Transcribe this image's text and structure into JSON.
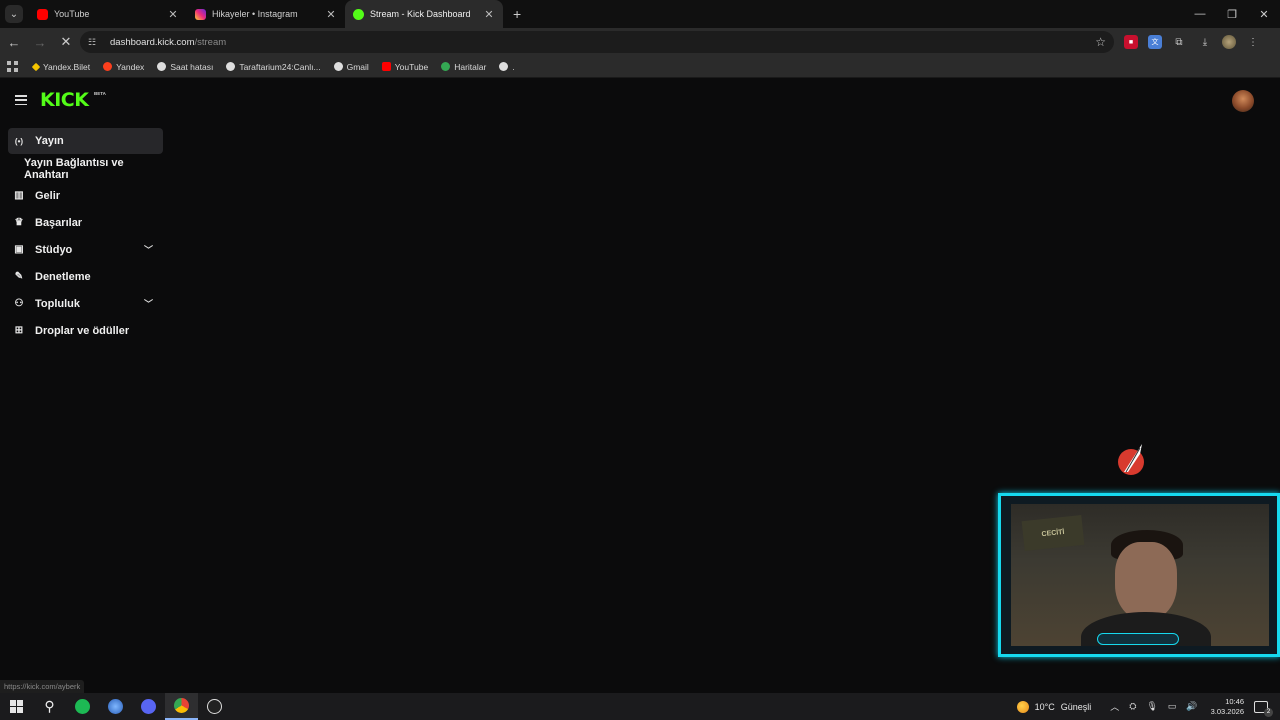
{
  "browser": {
    "tabs": [
      {
        "title": "YouTube",
        "favicon_color": "#ff0000",
        "active": false
      },
      {
        "title": "Hikayeler • Instagram",
        "favicon_color": "#d62976",
        "active": false
      },
      {
        "title": "Stream - Kick Dashboard",
        "favicon_color": "#53fc18",
        "active": true
      }
    ],
    "new_tab_glyph": "+",
    "window_controls": {
      "minimize": "—",
      "restore": "❐",
      "close": "✕"
    },
    "address": {
      "host": "dashboard.kick.com",
      "path": "/stream"
    },
    "bookmarks": [
      {
        "label": "Yandex.Bilet",
        "icon_color": "#f7c600"
      },
      {
        "label": "Yandex",
        "icon_color": "#fc3f1d"
      },
      {
        "label": "Saat hatası",
        "icon_color": "#dddddd"
      },
      {
        "label": "Taraftarium24:Canlı...",
        "icon_color": "#dddddd"
      },
      {
        "label": "Gmail",
        "icon_color": "#dddddd"
      },
      {
        "label": "YouTube",
        "icon_color": "#ff0000"
      },
      {
        "label": "Haritalar",
        "icon_color": "#34a853"
      },
      {
        "label": ".",
        "icon_color": "#dddddd"
      }
    ]
  },
  "kick": {
    "logo_text": "KICK",
    "logo_badge": "BETA",
    "brand_color": "#53fc18",
    "sidebar": [
      {
        "label": "Yayın",
        "icon": "broadcast-icon",
        "glyph": "((•))",
        "active": true
      },
      {
        "label": "Yayın Bağlantısı ve Anahtarı",
        "sub": true
      },
      {
        "label": "Gelir",
        "icon": "chart-icon",
        "glyph": "▥"
      },
      {
        "label": "Başarılar",
        "icon": "trophy-icon",
        "glyph": "🏆"
      },
      {
        "label": "Stüdyo",
        "icon": "studio-icon",
        "glyph": "▣",
        "expandable": true
      },
      {
        "label": "Denetleme",
        "icon": "wrench-icon",
        "glyph": "🔧"
      },
      {
        "label": "Topluluk",
        "icon": "community-icon",
        "glyph": "👥",
        "expandable": true
      },
      {
        "label": "Droplar ve ödüller",
        "icon": "gift-icon",
        "glyph": "🎁"
      }
    ]
  },
  "overlay": {
    "accent_color": "#16d9ef",
    "poster_text": "CECİTİ"
  },
  "status_url": "https://kick.com/ayberk",
  "taskbar": {
    "weather": {
      "temp": "10°C",
      "condition": "Güneşli"
    },
    "time": "10:46",
    "date": "3.03.2026",
    "notifications": "2"
  }
}
